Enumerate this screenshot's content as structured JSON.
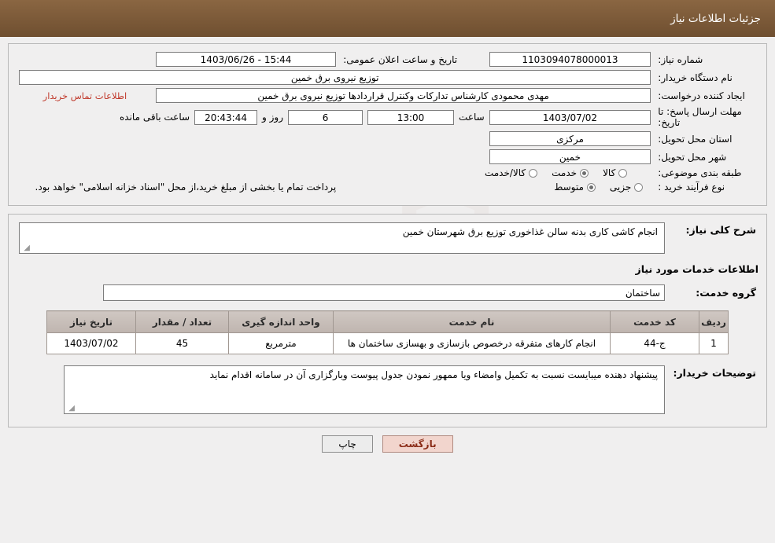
{
  "header": {
    "title": "جزئیات اطلاعات نیاز"
  },
  "watermark": {
    "text": "AriaTender.net"
  },
  "form": {
    "need_number_label": "شماره نیاز:",
    "need_number_value": "1103094078000013",
    "announce_datetime_label": "تاریخ و ساعت اعلان عمومی:",
    "announce_datetime_value": "15:44 - 1403/06/26",
    "buyer_org_label": "نام دستگاه خریدار:",
    "buyer_org_value": "توزیع نیروی برق خمین",
    "requester_label": "ایجاد کننده درخواست:",
    "requester_value": "مهدی محمودی کارشناس تدارکات وکنترل قراردادها توزیع نیروی برق خمین",
    "contact_link": "اطلاعات تماس خریدار",
    "deadline_label": "مهلت ارسال پاسخ: تا تاریخ:",
    "deadline_date": "1403/07/02",
    "hour_label": "ساعت",
    "deadline_time": "13:00",
    "days_value": "6",
    "days_label": "روز و",
    "remaining_value": "20:43:44",
    "remaining_label": "ساعت باقی مانده",
    "province_label": "استان محل تحویل:",
    "province_value": "مرکزی",
    "city_label": "شهر محل تحویل:",
    "city_value": "خمین",
    "category_label": "طبقه بندی موضوعی:",
    "category_options": [
      "کالا",
      "خدمت",
      "کالا/خدمت"
    ],
    "category_selected": "خدمت",
    "purchase_type_label": "نوع فرآیند خرید :",
    "purchase_type_options": [
      "جزیی",
      "متوسط"
    ],
    "purchase_type_selected": "متوسط",
    "purchase_note": "پرداخت تمام یا بخشی از مبلغ خرید،از محل \"اسناد خزانه اسلامی\" خواهد بود."
  },
  "summary": {
    "label": "شرح کلی نیاز:",
    "value": "انجام کاشی کاری بدنه سالن غذاخوری توزیع برق شهرستان خمین"
  },
  "services": {
    "title": "اطلاعات خدمات مورد نیاز",
    "group_label": "گروه خدمت:",
    "group_value": "ساختمان",
    "columns": [
      "ردیف",
      "کد خدمت",
      "نام خدمت",
      "واحد اندازه گیری",
      "تعداد / مقدار",
      "تاریخ نیاز"
    ],
    "rows": [
      {
        "row": "1",
        "code": "ج-44",
        "name": "انجام کارهای متفرقه درخصوص بازسازی و بهسازی ساختمان ها",
        "unit": "مترمربع",
        "quantity": "45",
        "date": "1403/07/02"
      }
    ]
  },
  "buyer_notes": {
    "label": "توضیحات خریدار:",
    "value": "پیشنهاد دهنده میبایست نسبت به تکمیل وامضاء ویا ممهور نمودن جدول پیوست وبارگزاری آن در سامانه اقدام نماید"
  },
  "footer": {
    "print_label": "چاپ",
    "back_label": "بازگشت"
  }
}
